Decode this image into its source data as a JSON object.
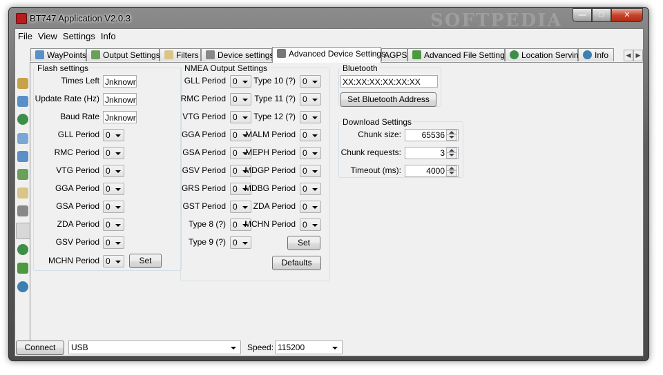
{
  "window": {
    "title": "BT747 Application V2.0.3",
    "watermark": "SOFTPEDIA"
  },
  "menu": [
    "File",
    "View",
    "Settings",
    "Info"
  ],
  "tabs": [
    {
      "label": "WayPoints",
      "icon": "waypoints-icon"
    },
    {
      "label": "Output Settings",
      "icon": "output-icon"
    },
    {
      "label": "Filters",
      "icon": "hourglass-icon"
    },
    {
      "label": "Device settings",
      "icon": "wrench-icon"
    },
    {
      "label": "Advanced Device Settings",
      "icon": "wrench-plus-icon",
      "active": true
    },
    {
      "label": "AGPS",
      "icon": ""
    },
    {
      "label": "Advanced File Settings",
      "icon": "arrow-right-icon"
    },
    {
      "label": "Location Serving",
      "icon": "globe-icon"
    },
    {
      "label": "Info",
      "icon": "info-icon"
    }
  ],
  "flash": {
    "title": "Flash settings",
    "times_left_label": "Times Left",
    "times_left_value": "Jnknown",
    "update_rate_label": "Update Rate (Hz)",
    "update_rate_value": "Jnknown",
    "baud_rate_label": "Baud Rate",
    "baud_rate_value": "Jnknown",
    "periods": [
      {
        "label": "GLL Period",
        "value": "0"
      },
      {
        "label": "RMC Period",
        "value": "0"
      },
      {
        "label": "VTG Period",
        "value": "0"
      },
      {
        "label": "GGA Period",
        "value": "0"
      },
      {
        "label": "GSA Period",
        "value": "0"
      },
      {
        "label": "ZDA Period",
        "value": "0"
      },
      {
        "label": "GSV Period",
        "value": "0"
      },
      {
        "label": "MCHN Period",
        "value": "0"
      }
    ],
    "set_label": "Set"
  },
  "nmea": {
    "title": "NMEA Output Settings",
    "left": [
      {
        "label": "GLL Period",
        "value": "0"
      },
      {
        "label": "RMC Period",
        "value": "0"
      },
      {
        "label": "VTG Period",
        "value": "0"
      },
      {
        "label": "GGA Period",
        "value": "0"
      },
      {
        "label": "GSA Period",
        "value": "0"
      },
      {
        "label": "GSV Period",
        "value": "0"
      },
      {
        "label": "GRS Period",
        "value": "0"
      },
      {
        "label": "GST Period",
        "value": "0"
      },
      {
        "label": "Type 8 (?)",
        "value": "0"
      },
      {
        "label": "Type 9 (?)",
        "value": "0"
      }
    ],
    "right": [
      {
        "label": "Type 10 (?)",
        "value": "0"
      },
      {
        "label": "Type 11 (?)",
        "value": "0"
      },
      {
        "label": "Type 12 (?)",
        "value": "0"
      },
      {
        "label": "MALM Period",
        "value": "0"
      },
      {
        "label": "MEPH Period",
        "value": "0"
      },
      {
        "label": "MDGP Period",
        "value": "0"
      },
      {
        "label": "MDBG Period",
        "value": "0"
      },
      {
        "label": "ZDA Period",
        "value": "0"
      },
      {
        "label": "MCHN Period",
        "value": "0"
      }
    ],
    "set_label": "Set",
    "defaults_label": "Defaults"
  },
  "bluetooth": {
    "title": "Bluetooth",
    "address": "XX:XX:XX:XX:XX:XX",
    "set_address_label": "Set Bluetooth Address"
  },
  "download": {
    "title": "Download Settings",
    "chunk_size_label": "Chunk size:",
    "chunk_size_value": "65536",
    "chunk_requests_label": "Chunk requests:",
    "chunk_requests_value": "3",
    "timeout_label": "Timeout (ms):",
    "timeout_value": "4000"
  },
  "bottom": {
    "connect_label": "Connect",
    "port_value": "USB",
    "speed_label": "Speed:",
    "speed_value": "115200"
  },
  "sidebar_icons": [
    "home-icon",
    "pages-icon",
    "globe-icon",
    "document-icon",
    "map-icon",
    "upload-icon",
    "hourglass-icon",
    "wrench-icon",
    "wrench-plus-icon",
    "globe-arrow-icon",
    "arrow-right-icon",
    "info-icon"
  ],
  "colors": {
    "accent": "#3c7fb1",
    "window_frame": "#5e5e5e",
    "close_button": "#c6432b"
  }
}
